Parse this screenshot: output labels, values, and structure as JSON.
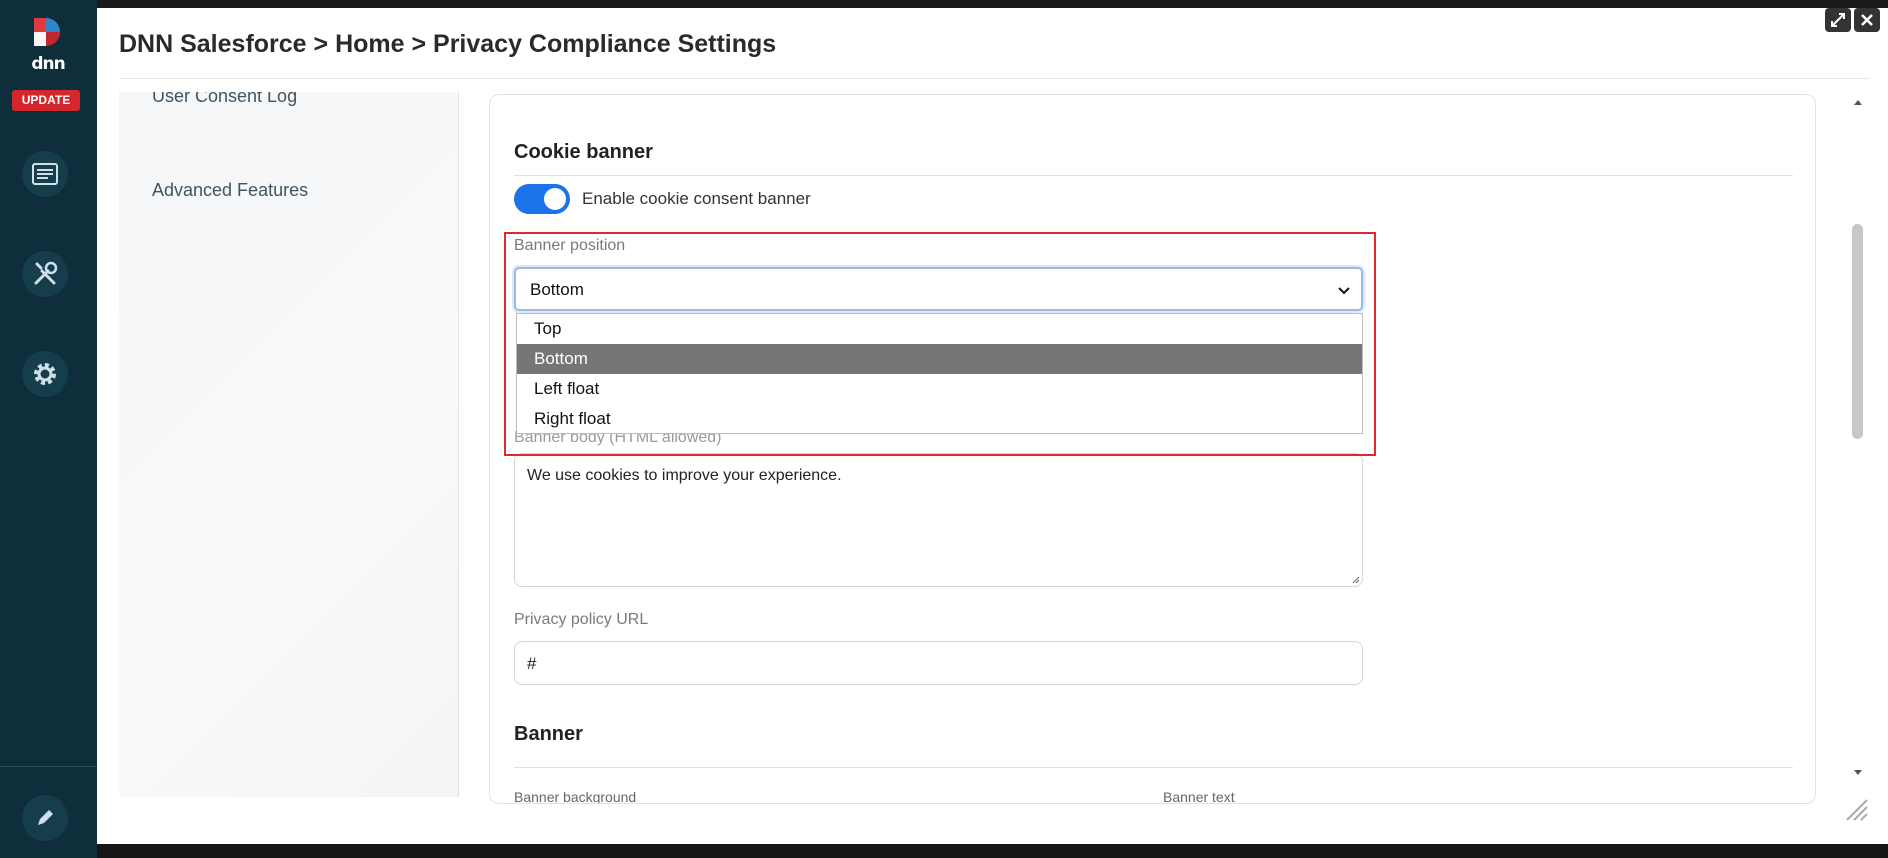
{
  "window": {
    "breadcrumb": "DNN Salesforce > Home > Privacy Compliance Settings"
  },
  "rail": {
    "logo_text": "dnn",
    "update_label": "UPDATE",
    "icons": [
      "content-icon",
      "tools-icon",
      "gear-icon",
      "pencil-icon"
    ]
  },
  "sidebar": {
    "items": [
      {
        "label": "User Consent Log"
      },
      {
        "label": "Advanced Features"
      }
    ]
  },
  "main": {
    "cookie_section_title": "Cookie banner",
    "toggle": {
      "label": "Enable cookie consent banner",
      "on": true
    },
    "banner_position": {
      "label": "Banner position",
      "value": "Bottom",
      "options": [
        "Top",
        "Bottom",
        "Left float",
        "Right float"
      ],
      "selected_index": 1
    },
    "banner_body": {
      "label": "Banner body (HTML allowed)",
      "value": "We use cookies to improve your experience."
    },
    "privacy_url": {
      "label": "Privacy policy URL",
      "value": "#"
    },
    "banner_section_title": "Banner",
    "cut_labels": [
      "Banner background",
      "Banner text"
    ]
  },
  "colors": {
    "rail": "#0f2e3b",
    "accent": "#1a73e8",
    "update_badge": "#d3262d",
    "highlight": "#e0282e"
  }
}
